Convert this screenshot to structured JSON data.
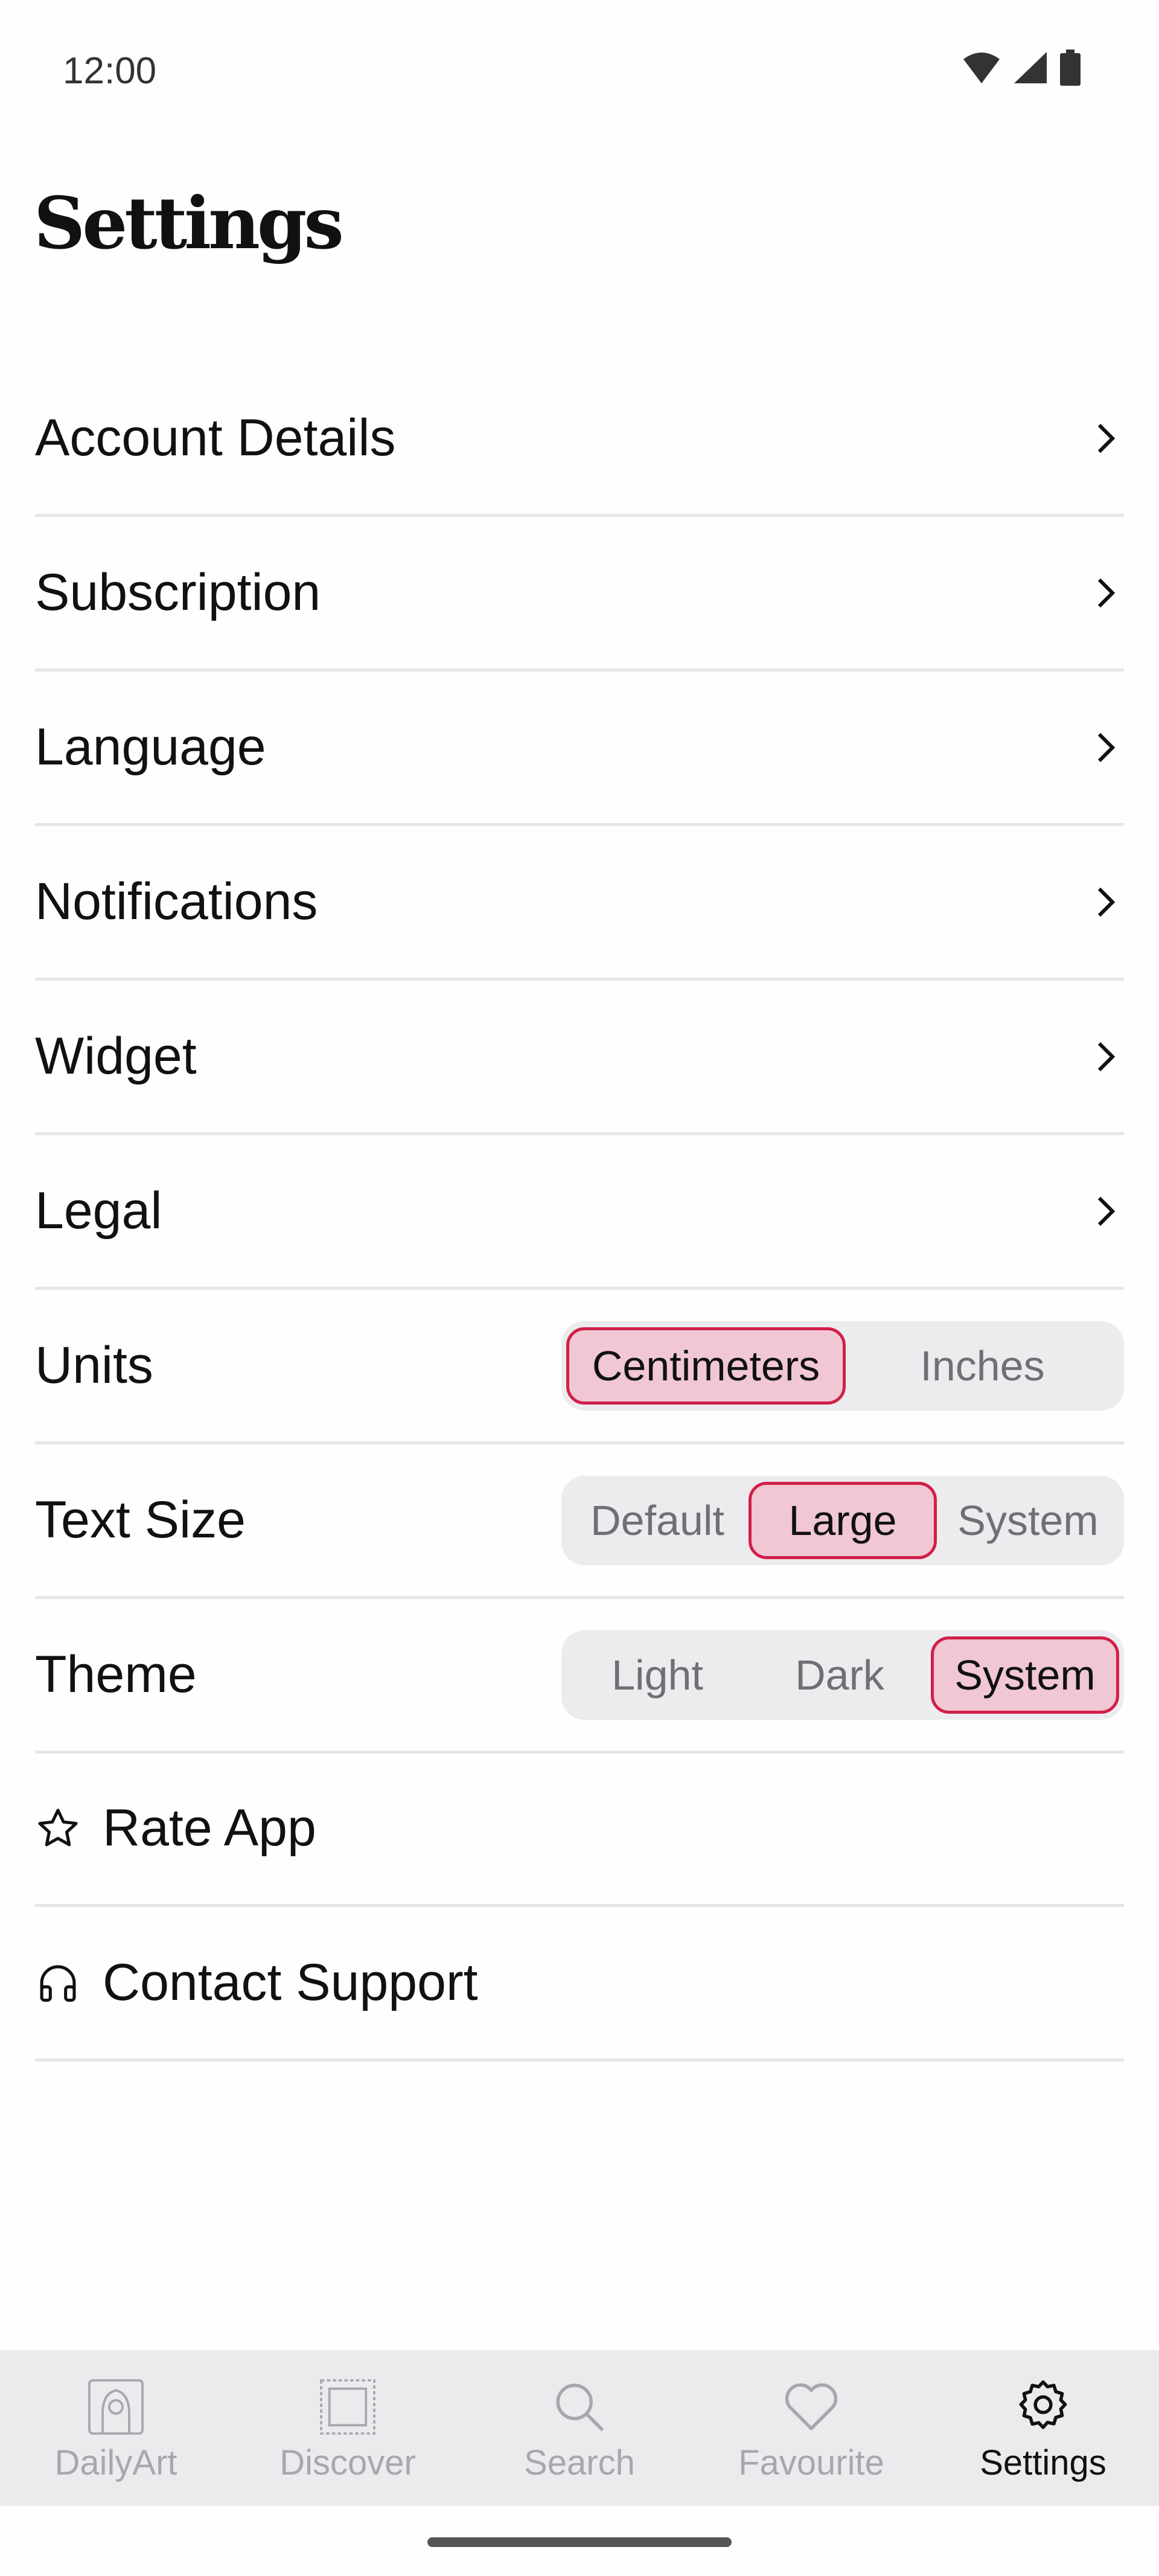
{
  "status_bar": {
    "time": "12:00"
  },
  "page": {
    "title": "Settings"
  },
  "nav_rows": [
    {
      "label": "Account Details"
    },
    {
      "label": "Subscription"
    },
    {
      "label": "Language"
    },
    {
      "label": "Notifications"
    },
    {
      "label": "Widget"
    },
    {
      "label": "Legal"
    }
  ],
  "units": {
    "label": "Units",
    "options": [
      "Centimeters",
      "Inches"
    ],
    "selected": "Centimeters"
  },
  "text_size": {
    "label": "Text Size",
    "options": [
      "Default",
      "Large",
      "System"
    ],
    "selected": "Large"
  },
  "theme": {
    "label": "Theme",
    "options": [
      "Light",
      "Dark",
      "System"
    ],
    "selected": "System"
  },
  "actions": [
    {
      "label": "Rate App",
      "icon": "star-icon"
    },
    {
      "label": "Contact Support",
      "icon": "headset-icon"
    }
  ],
  "bottom_nav": [
    {
      "label": "DailyArt",
      "icon": "painting-figure-icon"
    },
    {
      "label": "Discover",
      "icon": "framed-picture-icon"
    },
    {
      "label": "Search",
      "icon": "search-icon"
    },
    {
      "label": "Favourite",
      "icon": "heart-icon"
    },
    {
      "label": "Settings",
      "icon": "gear-icon",
      "active": true
    }
  ],
  "colors": {
    "accent": "#d11f49",
    "accent_fill": "#f0c7d2",
    "segment_bg": "#ececee",
    "nav_bg": "#ebebee"
  }
}
